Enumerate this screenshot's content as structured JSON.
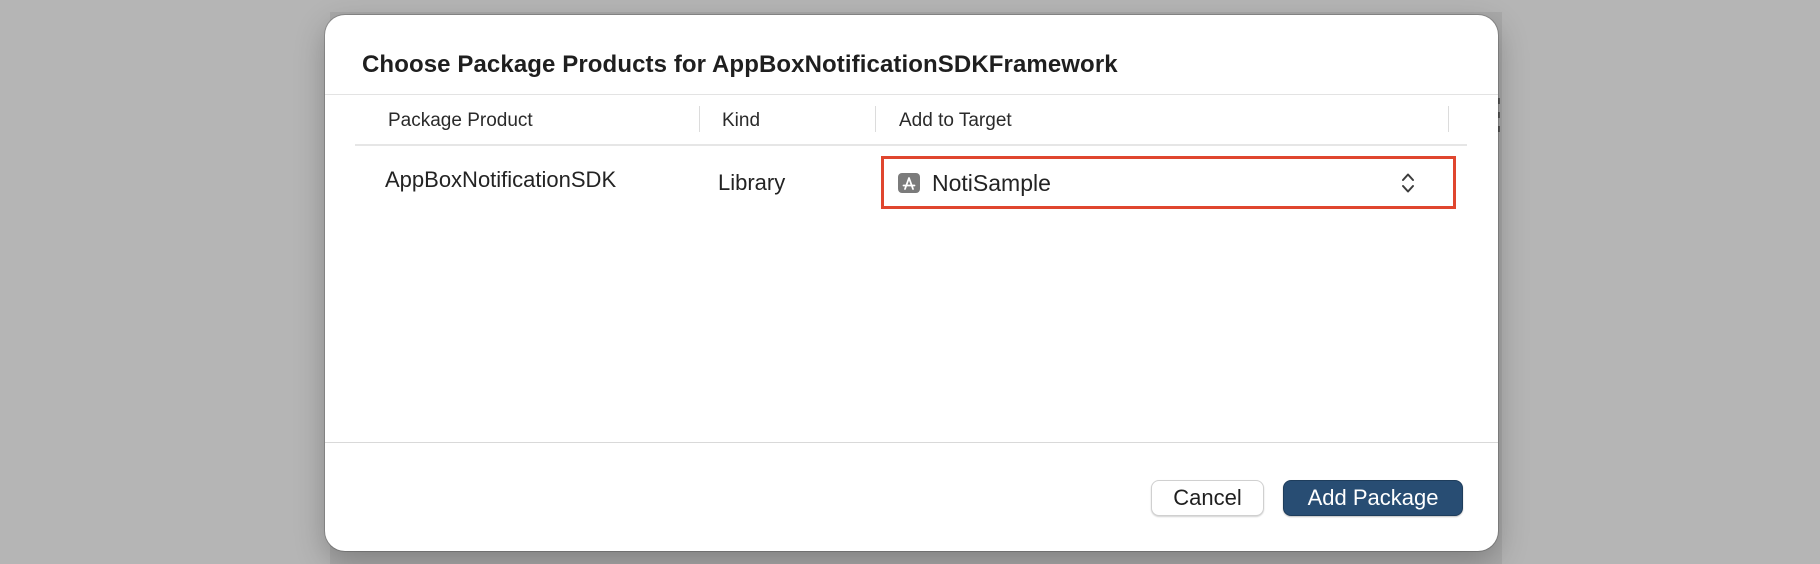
{
  "dialog": {
    "title": "Choose Package Products for AppBoxNotificationSDKFramework"
  },
  "table": {
    "columns": [
      "Package Product",
      "Kind",
      "Add to Target"
    ],
    "rows": [
      {
        "product": "AppBoxNotificationSDK",
        "kind": "Library",
        "target": {
          "value": "NotiSample",
          "icon": "app-target-icon"
        }
      }
    ]
  },
  "footer": {
    "cancel_label": "Cancel",
    "add_label": "Add Package"
  },
  "colors": {
    "highlight_border": "#e0462f",
    "primary_button": "#284d73"
  }
}
